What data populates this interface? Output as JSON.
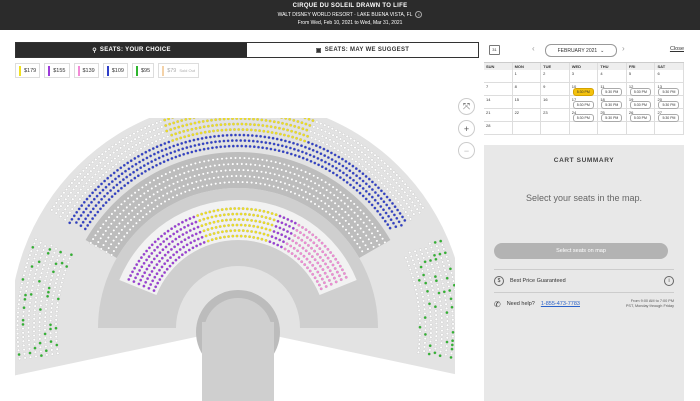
{
  "header": {
    "title": "CIRQUE DU SOLEIL DRAWN TO LIFE",
    "venue": "WALT DISNEY WORLD RESORT · LAKE BUENA VISTA, FL",
    "dates": "From Wed, Feb 10, 2021 to Wed, Mar 31, 2021",
    "info_icon": "i"
  },
  "tabs": [
    {
      "label": "SEATS: YOUR CHOICE",
      "icon": "map-pin-icon"
    },
    {
      "label": "SEATS: MAY WE SUGGEST",
      "icon": "sofa-icon"
    }
  ],
  "prices": [
    {
      "label": "$179",
      "color": "#f0e020"
    },
    {
      "label": "$155",
      "color": "#9b3ad9"
    },
    {
      "label": "$139",
      "color": "#f28ad6"
    },
    {
      "label": "$109",
      "color": "#2f3fc8"
    },
    {
      "label": "$95",
      "color": "#2fb52f"
    },
    {
      "label": "$79",
      "sold": "Sold Out",
      "color": "#f4d2a8"
    }
  ],
  "map_controls": {
    "fit": "⤧",
    "zoom_in": "+",
    "zoom_out": "−"
  },
  "calendar": {
    "month": "FEBRUARY 2021",
    "prev": "‹",
    "next": "›",
    "close": "Close",
    "icon_label": "31",
    "days": [
      "SUN",
      "MON",
      "TUE",
      "WED",
      "THU",
      "FRI",
      "SAT"
    ],
    "weeks": [
      [
        {
          "d": ""
        },
        {
          "d": "1"
        },
        {
          "d": "2"
        },
        {
          "d": "3"
        },
        {
          "d": "4"
        },
        {
          "d": "5"
        },
        {
          "d": "6"
        }
      ],
      [
        {
          "d": "7"
        },
        {
          "d": "8"
        },
        {
          "d": "9"
        },
        {
          "d": "10",
          "t": "5:30 PM",
          "sel": true
        },
        {
          "d": "11",
          "t": "5:30 PM"
        },
        {
          "d": "12",
          "t": "5:30 PM"
        },
        {
          "d": "13",
          "t": "5:30 PM"
        }
      ],
      [
        {
          "d": "14"
        },
        {
          "d": "15"
        },
        {
          "d": "16"
        },
        {
          "d": "17",
          "t": "5:30 PM"
        },
        {
          "d": "18",
          "t": "5:30 PM"
        },
        {
          "d": "19",
          "t": "5:30 PM"
        },
        {
          "d": "20",
          "t": "5:30 PM"
        }
      ],
      [
        {
          "d": "21"
        },
        {
          "d": "22"
        },
        {
          "d": "23"
        },
        {
          "d": "24",
          "t": "5:30 PM"
        },
        {
          "d": "25",
          "t": "5:30 PM"
        },
        {
          "d": "26",
          "t": "5:30 PM"
        },
        {
          "d": "27",
          "t": "5:30 PM"
        }
      ],
      [
        {
          "d": "28"
        },
        {
          "d": ""
        },
        {
          "d": ""
        },
        {
          "d": ""
        },
        {
          "d": ""
        },
        {
          "d": ""
        },
        {
          "d": ""
        }
      ]
    ]
  },
  "cart": {
    "title": "CART SUMMARY",
    "hint": "Select your seats in the map.",
    "button": "Select seats on map",
    "guarantee": "Best Price Guaranteed",
    "guarantee_icon": "$",
    "info_icon": "i",
    "help_label": "Need help?",
    "phone": "1-855-473-7783",
    "hours_1": "From 9:00 AM to 7:00 PM",
    "hours_2": "PST, Monday through Friday"
  }
}
